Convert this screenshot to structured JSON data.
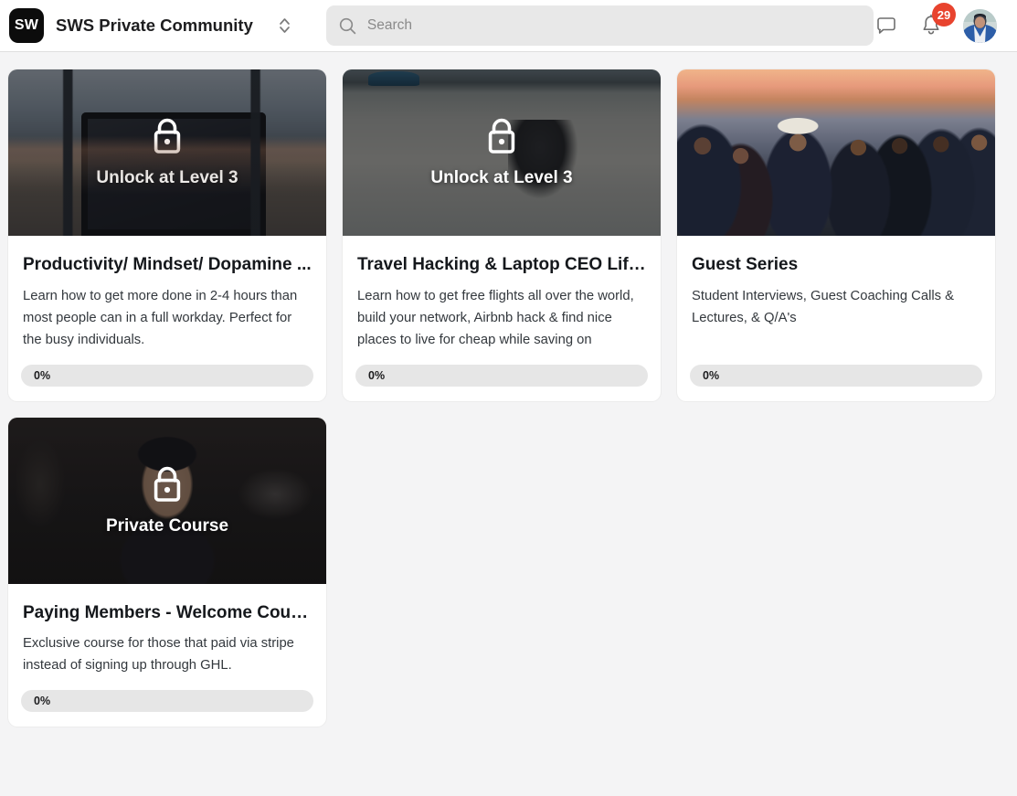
{
  "header": {
    "logo_text": "SW",
    "title": "SWS Private Community",
    "switcher_icon": "chevron-up-down-icon",
    "search": {
      "icon": "search-icon",
      "placeholder": "Search",
      "value": ""
    },
    "messages_icon": "chat-bubble-icon",
    "notifications_icon": "bell-icon",
    "notifications_count": "29",
    "avatar_label": "",
    "badge_color": "#e8432e"
  },
  "courses": [
    {
      "id": "productivity",
      "photo": "ph-laptop",
      "locked": true,
      "lock_icon": "lock-icon",
      "lock_label": "Unlock at Level 3",
      "title": "Productivity/ Mindset/ Dopamine ...",
      "description": "Learn how to get more done in 2-4 hours than most people can in a full workday. Perfect for the busy individuals.",
      "progress_text": "0%",
      "progress_value": 0
    },
    {
      "id": "travel-hacking",
      "photo": "ph-surf",
      "locked": true,
      "lock_icon": "lock-icon",
      "lock_label": "Unlock at Level 3",
      "title": "Travel Hacking & Laptop CEO Life...",
      "description": "Learn how to get free flights all over the world, build your network, Airbnb hack & find nice places to live for cheap while saving on",
      "progress_text": "0%",
      "progress_value": 0
    },
    {
      "id": "guest-series",
      "photo": "ph-group",
      "locked": false,
      "lock_icon": "",
      "lock_label": "",
      "title": "Guest Series",
      "description": "Student Interviews, Guest Coaching Calls & Lectures, & Q/A's",
      "progress_text": "0%",
      "progress_value": 0
    },
    {
      "id": "paying-members",
      "photo": "ph-studio",
      "locked": true,
      "lock_icon": "lock-icon",
      "lock_label": "Private Course",
      "title": "Paying Members - Welcome Course",
      "description": "Exclusive course for those that paid via stripe instead of signing up through GHL.",
      "progress_text": "0%",
      "progress_value": 0
    }
  ]
}
